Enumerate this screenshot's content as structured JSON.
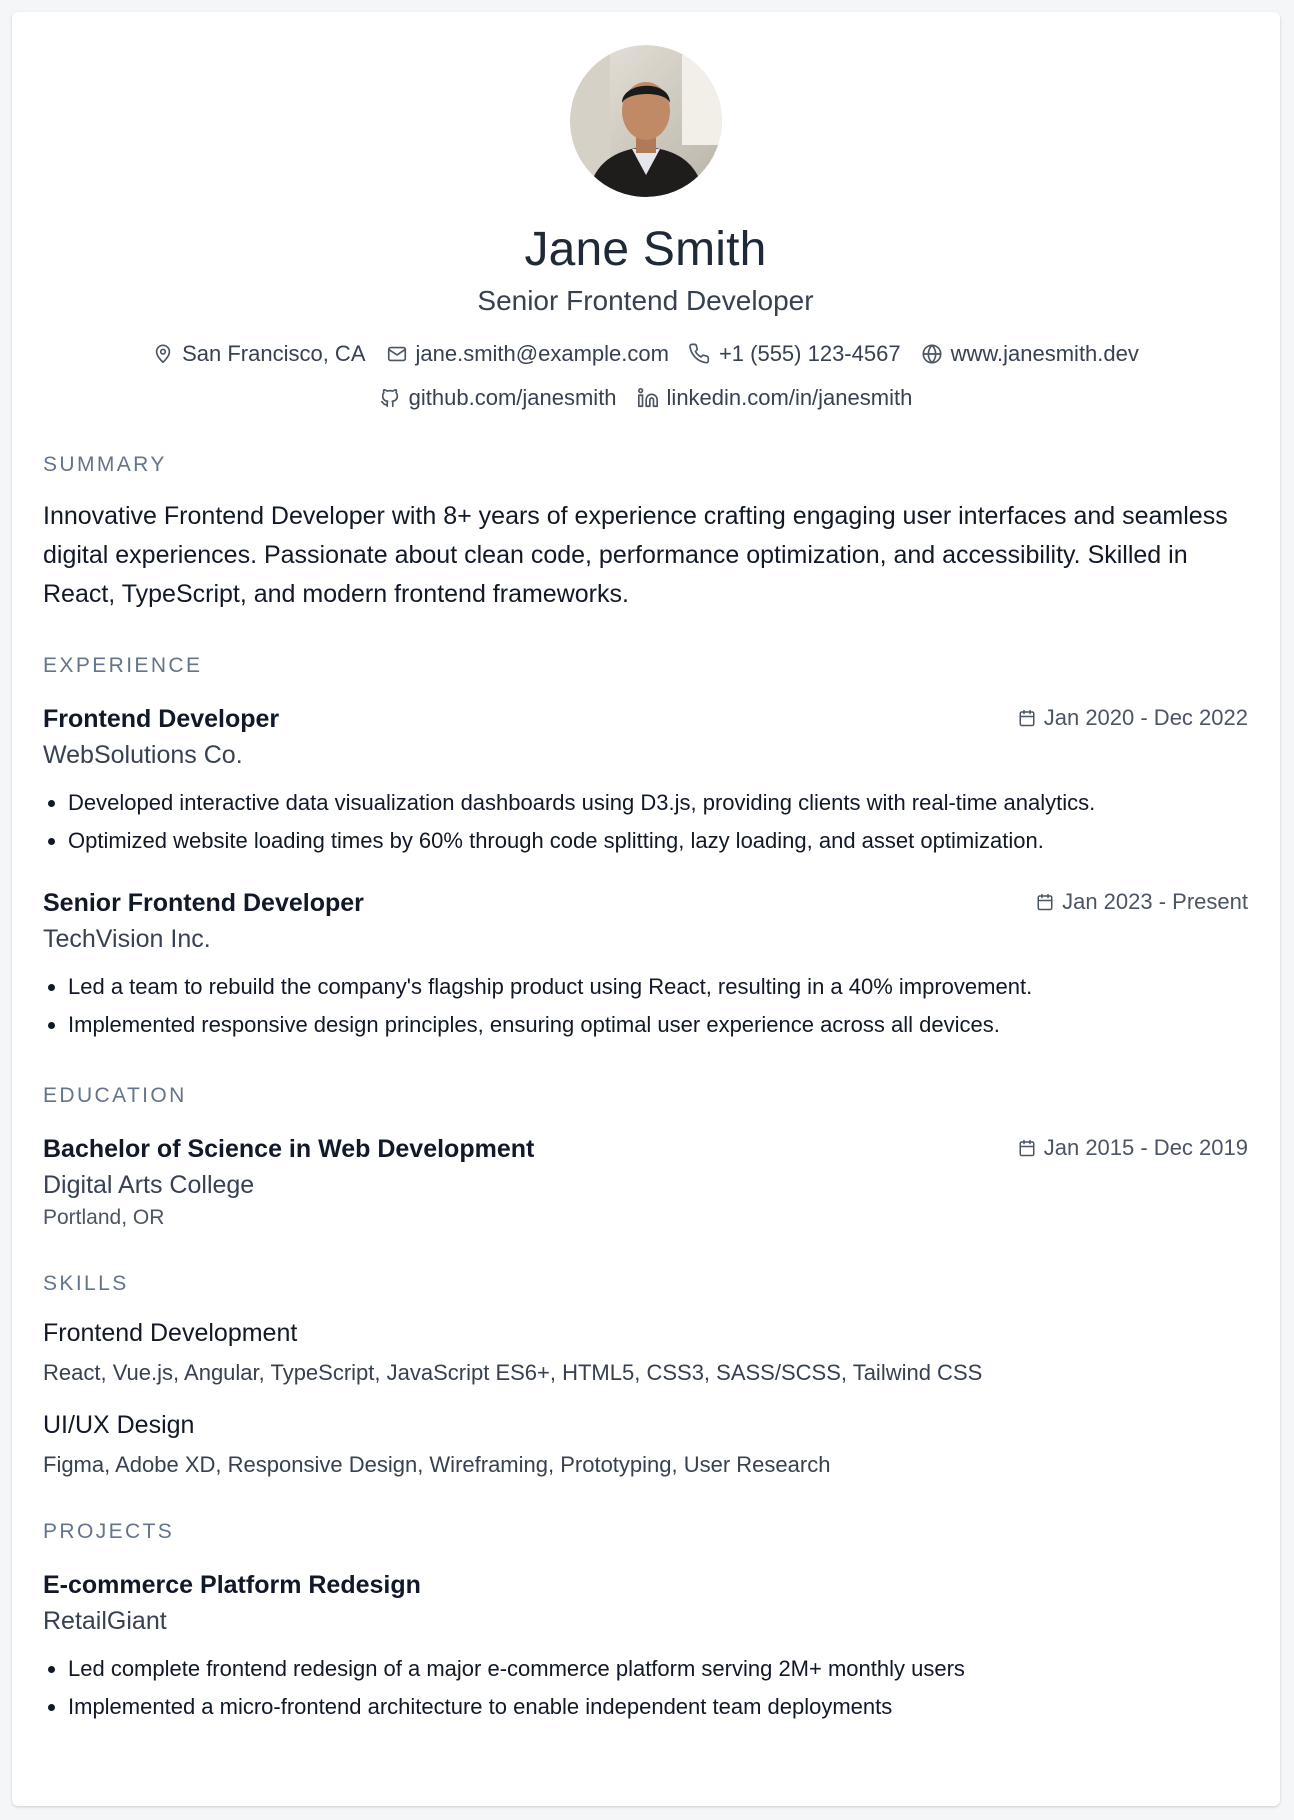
{
  "header": {
    "name": "Jane Smith",
    "title": "Senior Frontend Developer",
    "contacts": {
      "location": "San Francisco, CA",
      "email": "jane.smith@example.com",
      "phone": "+1 (555) 123-4567",
      "website": "www.janesmith.dev",
      "github": "github.com/janesmith",
      "linkedin": "linkedin.com/in/janesmith"
    }
  },
  "summary": {
    "heading": "SUMMARY",
    "text": "Innovative Frontend Developer with 8+ years of experience crafting engaging user interfaces and seamless digital experiences. Passionate about clean code, performance optimization, and accessibility. Skilled in React, TypeScript, and modern frontend frameworks."
  },
  "experience": {
    "heading": "EXPERIENCE",
    "items": [
      {
        "role": "Frontend Developer",
        "company": "WebSolutions Co.",
        "dates": "Jan 2020 - Dec 2022",
        "bullets": [
          "Developed interactive data visualization dashboards using D3.js, providing clients with real-time analytics.",
          "Optimized website loading times by 60% through code splitting, lazy loading, and asset optimization."
        ]
      },
      {
        "role": "Senior Frontend Developer",
        "company": "TechVision Inc.",
        "dates": "Jan 2023 - Present",
        "bullets": [
          "Led a team to rebuild the company's flagship product using React, resulting in a 40% improvement.",
          "Implemented responsive design principles, ensuring optimal user experience across all devices."
        ]
      }
    ]
  },
  "education": {
    "heading": "EDUCATION",
    "items": [
      {
        "degree": "Bachelor of Science in Web Development",
        "school": "Digital Arts College",
        "location": "Portland, OR",
        "dates": "Jan 2015 - Dec 2019"
      }
    ]
  },
  "skills": {
    "heading": "SKILLS",
    "groups": [
      {
        "category": "Frontend Development",
        "items": "React, Vue.js, Angular, TypeScript, JavaScript ES6+, HTML5, CSS3, SASS/SCSS, Tailwind CSS"
      },
      {
        "category": "UI/UX Design",
        "items": "Figma, Adobe XD, Responsive Design, Wireframing, Prototyping, User Research"
      }
    ]
  },
  "projects": {
    "heading": "PROJECTS",
    "items": [
      {
        "name": "E-commerce Platform Redesign",
        "client": "RetailGiant",
        "bullets": [
          "Led complete frontend redesign of a major e-commerce platform serving 2M+ monthly users",
          "Implemented a micro-frontend architecture to enable independent team deployments"
        ]
      }
    ]
  },
  "icons": {
    "location": "map-pin-icon",
    "email": "mail-icon",
    "phone": "phone-icon",
    "website": "globe-icon",
    "github": "github-icon",
    "linkedin": "linkedin-icon",
    "date": "calendar-icon"
  },
  "colors": {
    "section_heading": "#64748b",
    "text": "#111827",
    "muted": "#374151",
    "background": "#f5f6f8",
    "card": "#ffffff"
  }
}
